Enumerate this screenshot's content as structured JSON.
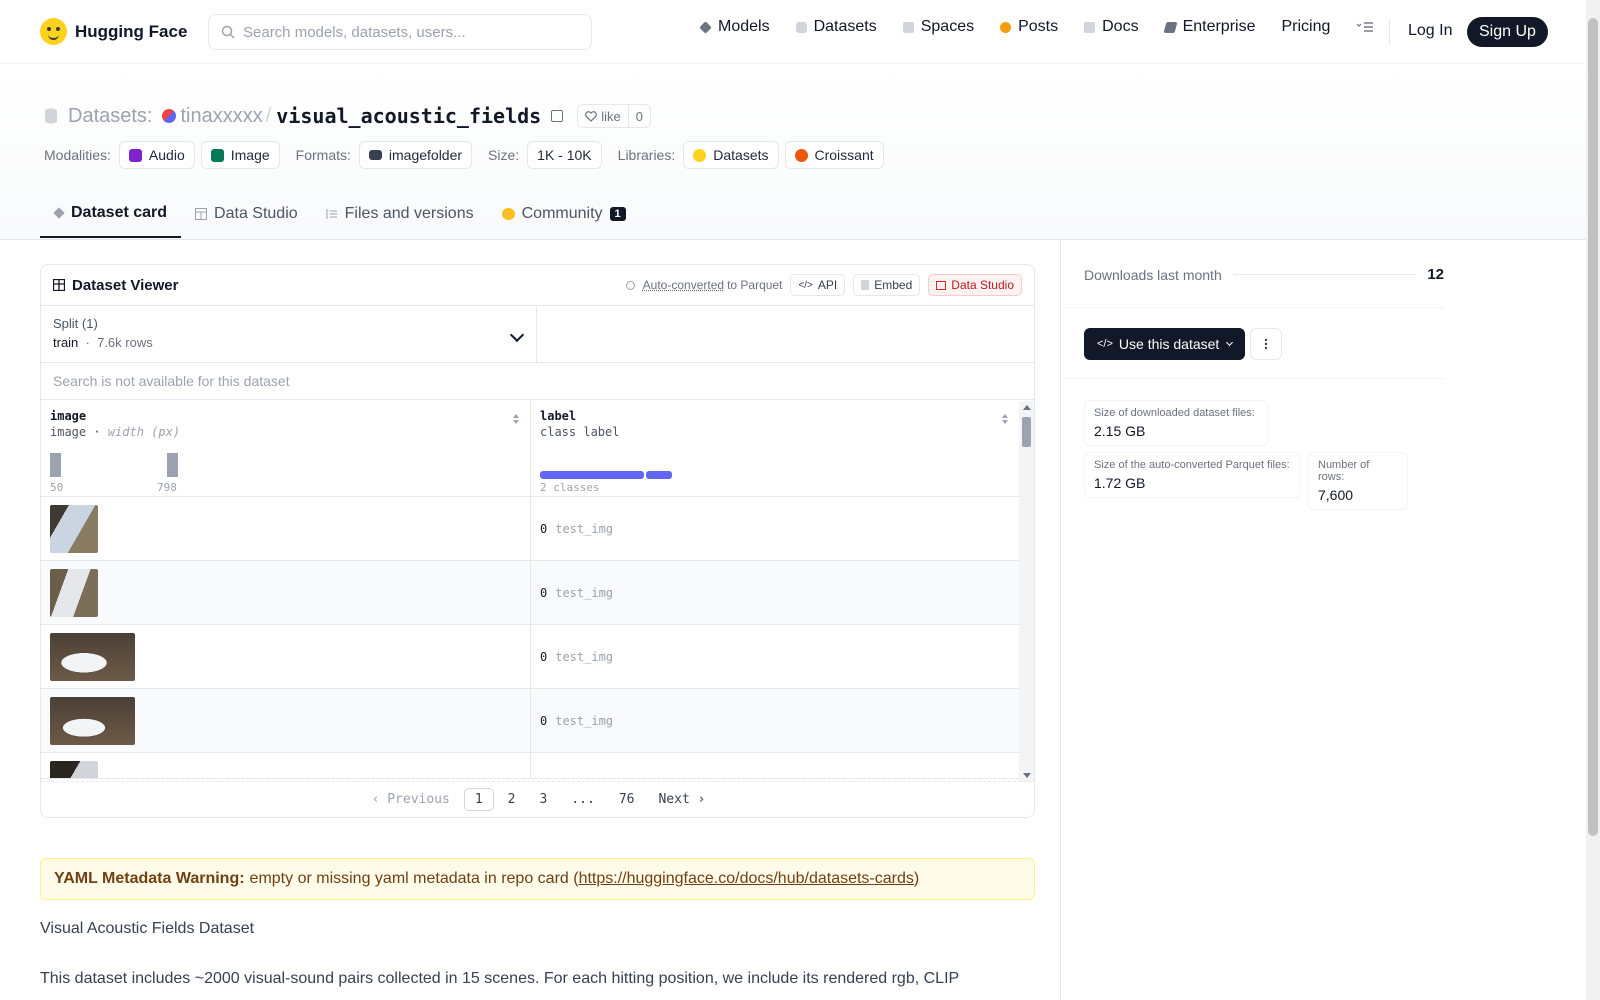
{
  "navbar": {
    "brand": "Hugging Face",
    "search_placeholder": "Search models, datasets, users...",
    "links": [
      {
        "label": "Models",
        "icon": "models-icon",
        "color": "#6b7280"
      },
      {
        "label": "Datasets",
        "icon": "datasets-icon",
        "color": "#9ca3af"
      },
      {
        "label": "Spaces",
        "icon": "spaces-icon",
        "color": "#9ca3af"
      },
      {
        "label": "Posts",
        "icon": "posts-icon",
        "color": "#f59e0b"
      },
      {
        "label": "Docs",
        "icon": "docs-icon",
        "color": "#9ca3af"
      },
      {
        "label": "Enterprise",
        "icon": "enterprise-icon",
        "color": "#6b7280"
      },
      {
        "label": "Pricing"
      }
    ],
    "login": "Log In",
    "signup": "Sign Up"
  },
  "header": {
    "section": "Datasets:",
    "owner": "tinaxxxxx",
    "separator": "/",
    "repo": "visual_acoustic_fields",
    "like_label": "like",
    "like_count": "0",
    "tags": {
      "modalities_label": "Modalities:",
      "modalities": [
        "Audio",
        "Image"
      ],
      "formats_label": "Formats:",
      "formats": [
        "imagefolder"
      ],
      "size_label": "Size:",
      "size": "1K - 10K",
      "libraries_label": "Libraries:",
      "libraries": [
        "Datasets",
        "Croissant"
      ]
    },
    "tabs": [
      {
        "label": "Dataset card",
        "active": true
      },
      {
        "label": "Data Studio"
      },
      {
        "label": "Files and versions"
      },
      {
        "label": "Community",
        "badge": "1"
      }
    ]
  },
  "viewer": {
    "title": "Dataset Viewer",
    "auto_converted": "Auto-converted",
    "to_parquet": "to Parquet",
    "api": "API",
    "embed": "Embed",
    "data_studio": "Data Studio",
    "split_label": "Split (1)",
    "split_value": "train",
    "split_rows": "7.6k rows",
    "search_na": "Search is not available for this dataset",
    "columns": [
      {
        "name": "image",
        "type": "image",
        "subtype": "width (px)",
        "hist_min": "50",
        "hist_max": "798"
      },
      {
        "name": "label",
        "type": "class label",
        "classes": "2 classes"
      }
    ],
    "rows": [
      {
        "label": "0",
        "class": "test_img",
        "thumb": "portrait"
      },
      {
        "label": "0",
        "class": "test_img",
        "thumb": "portrait"
      },
      {
        "label": "0",
        "class": "test_img",
        "thumb": "landscape"
      },
      {
        "label": "0",
        "class": "test_img",
        "thumb": "landscape"
      }
    ],
    "pager": {
      "prev": "Previous",
      "pages": [
        "1",
        "2",
        "3",
        "...",
        "76"
      ],
      "next": "Next"
    }
  },
  "sidebar": {
    "downloads_label": "Downloads last month",
    "downloads": "12",
    "use_button": "Use this dataset",
    "stats": [
      {
        "label": "Size of downloaded dataset files:",
        "value": "2.15 GB"
      },
      {
        "label": "Size of the auto-converted Parquet files:",
        "value": "1.72 GB"
      },
      {
        "label": "Number of rows:",
        "value": "7,600"
      }
    ]
  },
  "card": {
    "warning_bold": "YAML Metadata Warning:",
    "warning_text": "empty or missing yaml metadata in repo card (",
    "warning_link": "https://huggingface.co/docs/hub/datasets-cards",
    "warning_close": ")",
    "heading": "Visual Acoustic Fields Dataset",
    "paragraph": "This dataset includes ~2000 visual-sound pairs collected in 15 scenes. For each hitting position, we include its rendered rgb, CLIP"
  },
  "colors": {
    "accent_dark": "#111827",
    "class_bar": "#6366f1",
    "warning_bg": "#fefce8"
  }
}
